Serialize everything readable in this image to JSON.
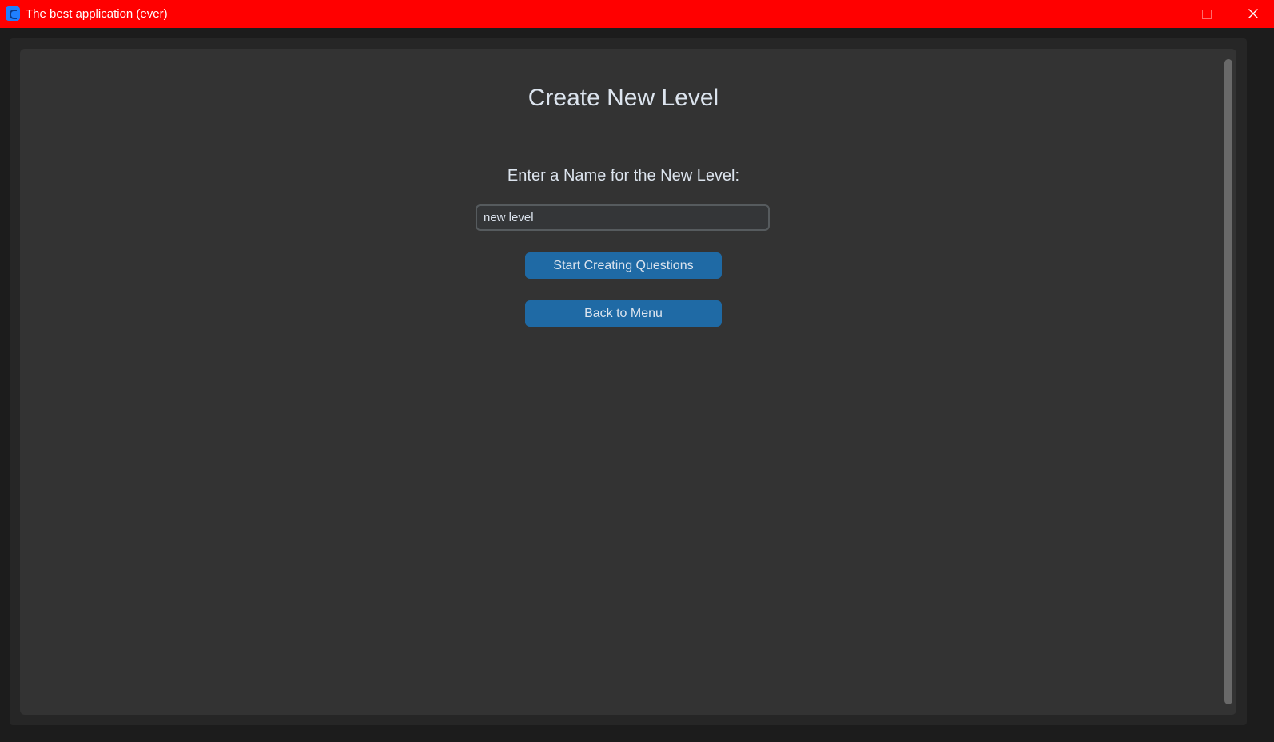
{
  "window": {
    "title": "The best application (ever)",
    "titlebar_color": "#ff0000",
    "icon": "app-logo-icon",
    "controls": {
      "minimize_icon": "minimize-icon",
      "maximize_icon": "maximize-icon",
      "close_icon": "close-icon"
    }
  },
  "theme": {
    "background": "#333333",
    "accent": "#1f6aa5",
    "text": "#dce4ee"
  },
  "main": {
    "heading": "Create New Level",
    "prompt": "Enter a Name for the New Level:",
    "level_name_input": {
      "value": "new level",
      "placeholder": ""
    },
    "start_button_label": "Start Creating Questions",
    "back_button_label": "Back to Menu"
  }
}
